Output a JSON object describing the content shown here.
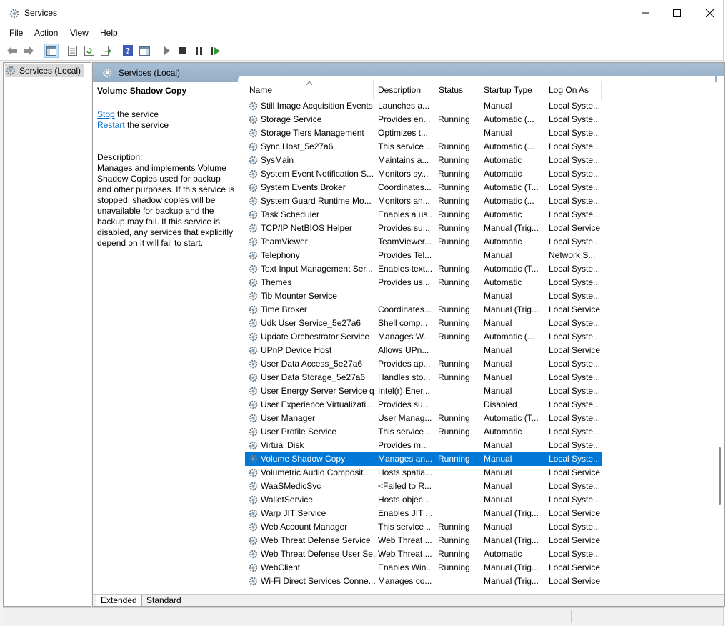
{
  "window": {
    "title": "Services"
  },
  "menu": [
    "File",
    "Action",
    "View",
    "Help"
  ],
  "tree": {
    "root_label": "Services (Local)"
  },
  "pane_header": "Services (Local)",
  "details": {
    "service_name": "Volume Shadow Copy",
    "stop_link": "Stop",
    "stop_suffix": " the service",
    "restart_link": "Restart",
    "restart_suffix": " the service",
    "description_label": "Description:",
    "description_text": "Manages and implements Volume Shadow Copies used for backup and other purposes. If this service is stopped, shadow copies will be unavailable for backup and the backup may fail. If this service is disabled, any services that explicitly depend on it will fail to start."
  },
  "columns": [
    "Name",
    "Description",
    "Status",
    "Startup Type",
    "Log On As"
  ],
  "services": [
    {
      "name": "Still Image Acquisition Events",
      "desc": "Launches a...",
      "status": "",
      "startup": "Manual",
      "logon": "Local Syste..."
    },
    {
      "name": "Storage Service",
      "desc": "Provides en...",
      "status": "Running",
      "startup": "Automatic (...",
      "logon": "Local Syste..."
    },
    {
      "name": "Storage Tiers Management",
      "desc": "Optimizes t...",
      "status": "",
      "startup": "Manual",
      "logon": "Local Syste..."
    },
    {
      "name": "Sync Host_5e27a6",
      "desc": "This service ...",
      "status": "Running",
      "startup": "Automatic (...",
      "logon": "Local Syste..."
    },
    {
      "name": "SysMain",
      "desc": "Maintains a...",
      "status": "Running",
      "startup": "Automatic",
      "logon": "Local Syste..."
    },
    {
      "name": "System Event Notification S...",
      "desc": "Monitors sy...",
      "status": "Running",
      "startup": "Automatic",
      "logon": "Local Syste..."
    },
    {
      "name": "System Events Broker",
      "desc": "Coordinates...",
      "status": "Running",
      "startup": "Automatic (T...",
      "logon": "Local Syste..."
    },
    {
      "name": "System Guard Runtime Mo...",
      "desc": "Monitors an...",
      "status": "Running",
      "startup": "Automatic (...",
      "logon": "Local Syste..."
    },
    {
      "name": "Task Scheduler",
      "desc": "Enables a us...",
      "status": "Running",
      "startup": "Automatic",
      "logon": "Local Syste..."
    },
    {
      "name": "TCP/IP NetBIOS Helper",
      "desc": "Provides su...",
      "status": "Running",
      "startup": "Manual (Trig...",
      "logon": "Local Service"
    },
    {
      "name": "TeamViewer",
      "desc": "TeamViewer...",
      "status": "Running",
      "startup": "Automatic",
      "logon": "Local Syste..."
    },
    {
      "name": "Telephony",
      "desc": "Provides Tel...",
      "status": "",
      "startup": "Manual",
      "logon": "Network S..."
    },
    {
      "name": "Text Input Management Ser...",
      "desc": "Enables text...",
      "status": "Running",
      "startup": "Automatic (T...",
      "logon": "Local Syste..."
    },
    {
      "name": "Themes",
      "desc": "Provides us...",
      "status": "Running",
      "startup": "Automatic",
      "logon": "Local Syste..."
    },
    {
      "name": "Tib Mounter Service",
      "desc": "",
      "status": "",
      "startup": "Manual",
      "logon": "Local Syste..."
    },
    {
      "name": "Time Broker",
      "desc": "Coordinates...",
      "status": "Running",
      "startup": "Manual (Trig...",
      "logon": "Local Service"
    },
    {
      "name": "Udk User Service_5e27a6",
      "desc": "Shell comp...",
      "status": "Running",
      "startup": "Manual",
      "logon": "Local Syste..."
    },
    {
      "name": "Update Orchestrator Service",
      "desc": "Manages W...",
      "status": "Running",
      "startup": "Automatic (...",
      "logon": "Local Syste..."
    },
    {
      "name": "UPnP Device Host",
      "desc": "Allows UPn...",
      "status": "",
      "startup": "Manual",
      "logon": "Local Service"
    },
    {
      "name": "User Data Access_5e27a6",
      "desc": "Provides ap...",
      "status": "Running",
      "startup": "Manual",
      "logon": "Local Syste..."
    },
    {
      "name": "User Data Storage_5e27a6",
      "desc": "Handles sto...",
      "status": "Running",
      "startup": "Manual",
      "logon": "Local Syste..."
    },
    {
      "name": "User Energy Server Service q...",
      "desc": "Intel(r) Ener...",
      "status": "",
      "startup": "Manual",
      "logon": "Local Syste..."
    },
    {
      "name": "User Experience Virtualizati...",
      "desc": "Provides su...",
      "status": "",
      "startup": "Disabled",
      "logon": "Local Syste..."
    },
    {
      "name": "User Manager",
      "desc": "User Manag...",
      "status": "Running",
      "startup": "Automatic (T...",
      "logon": "Local Syste..."
    },
    {
      "name": "User Profile Service",
      "desc": "This service ...",
      "status": "Running",
      "startup": "Automatic",
      "logon": "Local Syste..."
    },
    {
      "name": "Virtual Disk",
      "desc": "Provides m...",
      "status": "",
      "startup": "Manual",
      "logon": "Local Syste..."
    },
    {
      "name": "Volume Shadow Copy",
      "desc": "Manages an...",
      "status": "Running",
      "startup": "Manual",
      "logon": "Local Syste...",
      "selected": true
    },
    {
      "name": "Volumetric Audio Composit...",
      "desc": "Hosts spatia...",
      "status": "",
      "startup": "Manual",
      "logon": "Local Service"
    },
    {
      "name": "WaaSMedicSvc",
      "desc": "<Failed to R...",
      "status": "",
      "startup": "Manual",
      "logon": "Local Syste..."
    },
    {
      "name": "WalletService",
      "desc": "Hosts objec...",
      "status": "",
      "startup": "Manual",
      "logon": "Local Syste..."
    },
    {
      "name": "Warp JIT Service",
      "desc": "Enables JIT ...",
      "status": "",
      "startup": "Manual (Trig...",
      "logon": "Local Service"
    },
    {
      "name": "Web Account Manager",
      "desc": "This service ...",
      "status": "Running",
      "startup": "Manual",
      "logon": "Local Syste..."
    },
    {
      "name": "Web Threat Defense Service",
      "desc": "Web Threat ...",
      "status": "Running",
      "startup": "Manual (Trig...",
      "logon": "Local Service"
    },
    {
      "name": "Web Threat Defense User Se...",
      "desc": "Web Threat ...",
      "status": "Running",
      "startup": "Automatic",
      "logon": "Local Syste..."
    },
    {
      "name": "WebClient",
      "desc": "Enables Win...",
      "status": "Running",
      "startup": "Manual (Trig...",
      "logon": "Local Service"
    },
    {
      "name": "Wi-Fi Direct Services Conne...",
      "desc": "Manages co...",
      "status": "",
      "startup": "Manual (Trig...",
      "logon": "Local Service"
    }
  ],
  "tabs": [
    "Extended",
    "Standard"
  ],
  "colors": {
    "selection": "#0078d7",
    "link": "#0b6fd0",
    "header_band": "#a7bfd4"
  }
}
